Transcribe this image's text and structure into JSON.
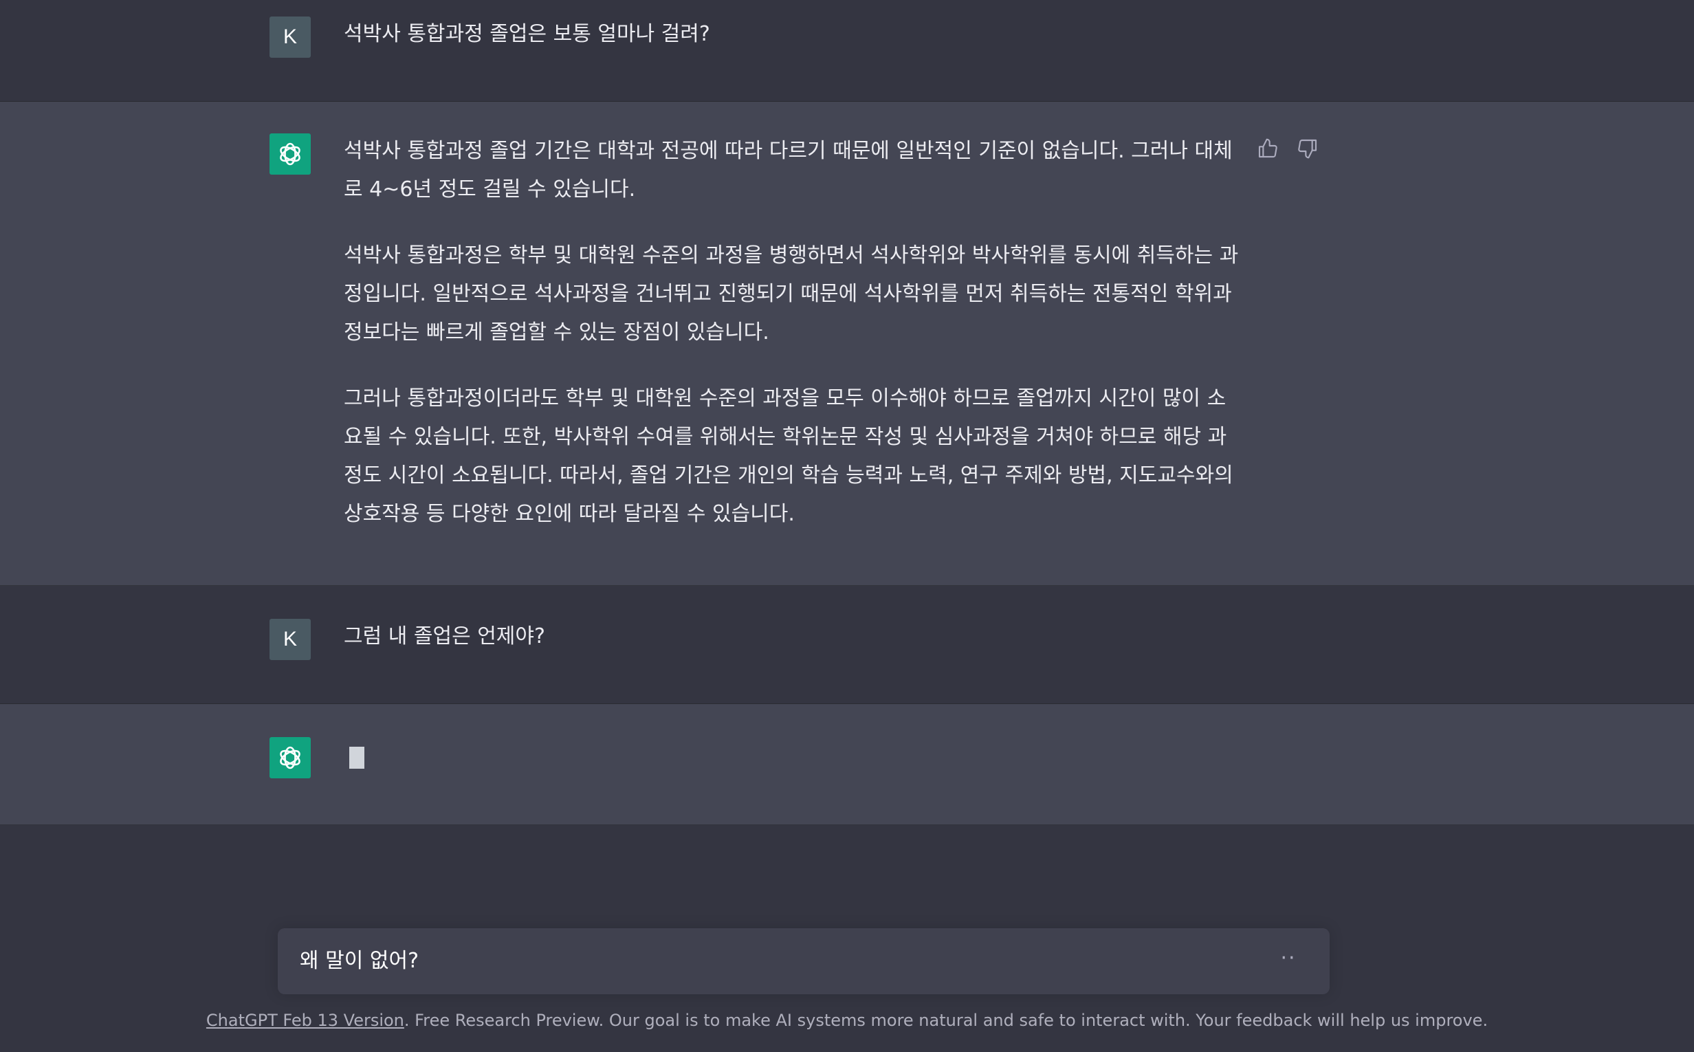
{
  "conversation": {
    "messages": [
      {
        "role": "user",
        "avatar_initial": "K",
        "text": "석박사 통합과정 졸업은 보통 얼마나 걸려?"
      },
      {
        "role": "assistant",
        "paragraphs": [
          "석박사 통합과정 졸업 기간은 대학과 전공에 따라 다르기 때문에 일반적인 기준이 없습니다. 그러나 대체로 4~6년 정도 걸릴 수 있습니다.",
          "석박사 통합과정은 학부 및 대학원 수준의 과정을 병행하면서 석사학위와 박사학위를 동시에 취득하는 과정입니다. 일반적으로 석사과정을 건너뛰고 진행되기 때문에 석사학위를 먼저 취득하는 전통적인 학위과정보다는 빠르게 졸업할 수 있는 장점이 있습니다.",
          "그러나 통합과정이더라도 학부 및 대학원 수준의 과정을 모두 이수해야 하므로 졸업까지 시간이 많이 소요될 수 있습니다. 또한, 박사학위 수여를 위해서는 학위논문 작성 및 심사과정을 거쳐야 하므로 해당 과정도 시간이 소요됩니다. 따라서, 졸업 기간은 개인의 학습 능력과 노력, 연구 주제와 방법, 지도교수와의 상호작용 등 다양한 요인에 따라 달라질 수 있습니다."
        ]
      },
      {
        "role": "user",
        "avatar_initial": "K",
        "text": "그럼 내 졸업은 언제야?"
      },
      {
        "role": "assistant",
        "state": "generating"
      }
    ]
  },
  "composer": {
    "value": "왜 말이 없어?",
    "loading_indicator": "··"
  },
  "footer": {
    "link_text": "ChatGPT Feb 13 Version",
    "text": ". Free Research Preview. Our goal is to make AI systems more natural and safe to interact with. Your feedback will help us improve."
  },
  "icons": {
    "assistant_avatar": "openai-logo-icon",
    "thumbs_up": "thumbs-up-icon",
    "thumbs_down": "thumbs-down-icon"
  },
  "colors": {
    "background": "#343541",
    "assistant_row": "#444654",
    "assistant_avatar": "#10a37f",
    "user_avatar": "#4a5a63",
    "composer": "#40414f"
  }
}
